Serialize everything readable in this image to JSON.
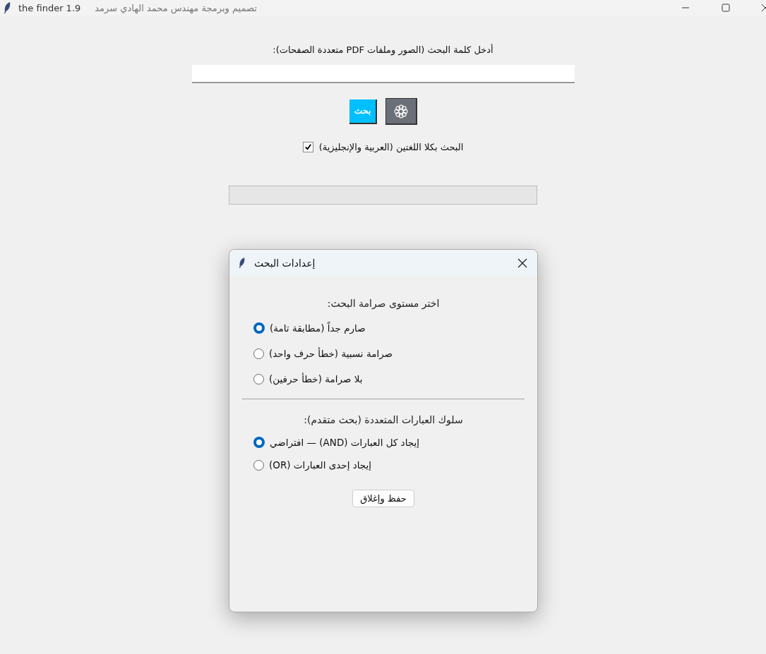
{
  "window": {
    "title": "the finder 1.9",
    "subtitle": "تصميم وبرمجة مهندس محمد الهادي سرمد"
  },
  "search": {
    "label": "أدخل كلمة البحث (الصور وملفات PDF متعددة الصفحات):",
    "search_button": "بحث"
  },
  "both_languages": {
    "label": "البحث بكلا اللغتين (العربية والإنجليزية)",
    "checked": true
  },
  "progress": {
    "level": 0
  },
  "dialog": {
    "title": "إعدادات البحث",
    "strictness": {
      "heading": "اختر مستوى صرامة البحث:",
      "options": [
        {
          "label": "صارم جداً (مطابقة تامة)",
          "selected": true
        },
        {
          "label": "صرامة نسبية (خطأ حرف واحد)",
          "selected": false
        },
        {
          "label": "بلا صرامة (خطأ حرفين)",
          "selected": false
        }
      ]
    },
    "phrases": {
      "heading": "سلوك العبارات المتعددة (بحث متقدم):",
      "options": [
        {
          "label": "إيجاد كل العبارات (AND) — افتراضي",
          "selected": true
        },
        {
          "label": "إيجاد إحدى العبارات (OR)",
          "selected": false
        }
      ]
    },
    "save_button": "حفظ وإغلاق"
  }
}
